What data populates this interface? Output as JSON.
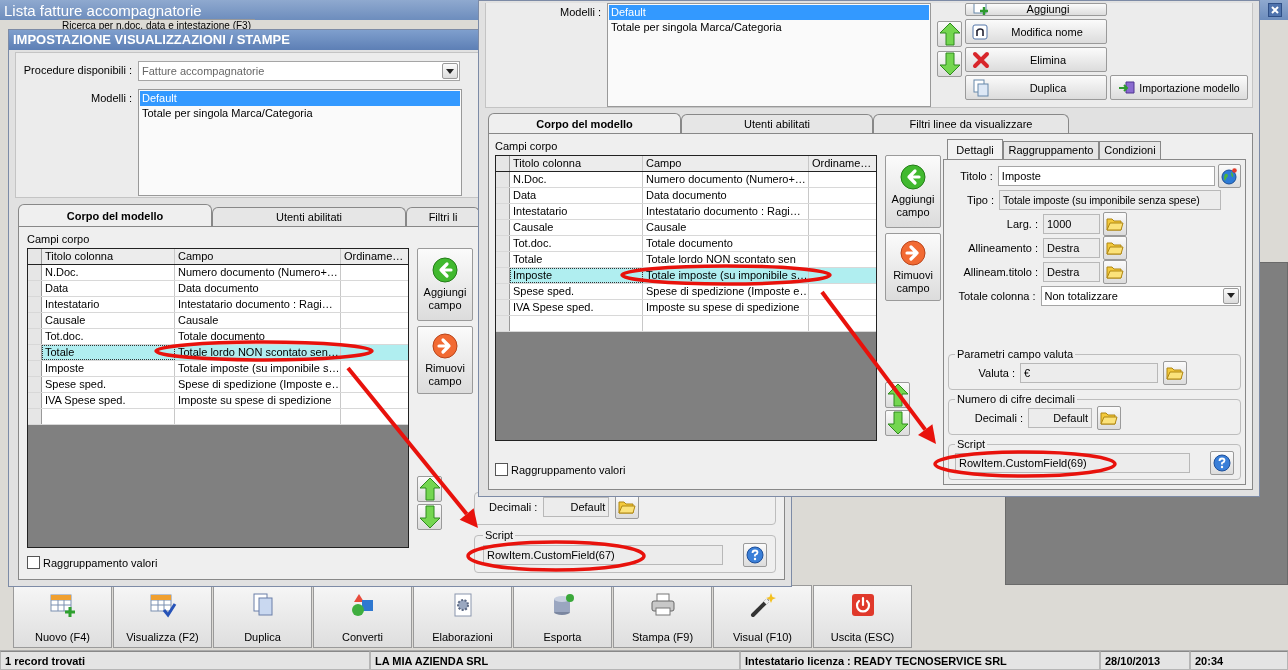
{
  "app": {
    "title": "Lista fatture accompagnatorie",
    "search_tab": "Ricerca per n.doc, data e intestazione (F3)",
    "toolbar": [
      "Nuovo (F4)",
      "Visualizza (F2)",
      "Duplica",
      "Converti",
      "Elaborazioni",
      "Esporta",
      "Stampa (F9)",
      "Visual (F10)",
      "Uscita (ESC)"
    ],
    "status_bar": [
      "1 record trovati",
      "LA MIA AZIENDA SRL",
      "Intestatario licenza : READY TECNOSERVICE SRL",
      "28/10/2013",
      "20:34"
    ]
  },
  "dialog_left": {
    "title": "IMPOSTAZIONE VISUALIZZAZIONI / STAMPE",
    "procedure": {
      "label": "Procedure disponibili :",
      "value": "Fatture accompagnatorie"
    },
    "models_label": "Modelli :",
    "models": [
      {
        "name": "Default",
        "selected": true
      },
      {
        "name": "Totale per singola Marca/Categoria",
        "selected": false
      }
    ],
    "tabs": [
      {
        "label": "Corpo del modello",
        "selected": true
      },
      {
        "label": "Utenti abilitati",
        "selected": false
      },
      {
        "label": "Filtri li",
        "selected": false
      }
    ],
    "fields_label": "Campi corpo",
    "columns": [
      "Titolo colonna",
      "Campo",
      "Ordiname…"
    ],
    "rows": [
      {
        "title": "N.Doc.",
        "field": "Numero documento (Numero+…",
        "selected": false
      },
      {
        "title": "Data",
        "field": "Data documento",
        "selected": false
      },
      {
        "title": "Intestatario",
        "field": "Intestatario documento : Ragi…",
        "selected": false
      },
      {
        "title": "Causale",
        "field": "Causale",
        "selected": false
      },
      {
        "title": "Tot.doc.",
        "field": "Totale documento",
        "selected": false
      },
      {
        "title": "Totale",
        "field": "Totale lordo NON scontato sen…",
        "selected": true
      },
      {
        "title": "Imposte",
        "field": "Totale imposte (su imponibile s…",
        "selected": false
      },
      {
        "title": "Spese sped.",
        "field": "Spese di spedizione (Imposte e…",
        "selected": false
      },
      {
        "title": "IVA Spese sped.",
        "field": "Imposte su spese di spedizione",
        "selected": false
      }
    ],
    "add_field": "Aggiungi campo",
    "remove_field": "Rimuovi campo",
    "grouping": {
      "label": "Raggruppamento valori",
      "checked": false
    },
    "decimals": {
      "label": "Decimali :",
      "value": "Default"
    },
    "script": {
      "group": "Script",
      "value": "RowItem.CustomField(67)"
    }
  },
  "dialog_right": {
    "models_label": "Modelli :",
    "models": [
      {
        "name": "Default",
        "selected": true
      },
      {
        "name": "Totale per singola Marca/Categoria",
        "selected": false
      }
    ],
    "model_buttons": [
      "Aggiungi",
      "Modifica nome",
      "Elimina",
      "Duplica"
    ],
    "import_button": "Importazione modello",
    "tabs": [
      {
        "label": "Corpo del modello",
        "selected": true
      },
      {
        "label": "Utenti abilitati",
        "selected": false
      },
      {
        "label": "Filtri linee da visualizzare",
        "selected": false
      }
    ],
    "fields_label": "Campi corpo",
    "columns": [
      "Titolo colonna",
      "Campo",
      "Ordiname…"
    ],
    "rows": [
      {
        "title": "N.Doc.",
        "field": "Numero documento (Numero+…",
        "selected": false
      },
      {
        "title": "Data",
        "field": "Data documento",
        "selected": false
      },
      {
        "title": "Intestatario",
        "field": "Intestatario documento : Ragi…",
        "selected": false
      },
      {
        "title": "Causale",
        "field": "Causale",
        "selected": false
      },
      {
        "title": "Tot.doc.",
        "field": "Totale documento",
        "selected": false
      },
      {
        "title": "Totale",
        "field": "Totale lordo NON scontato sen",
        "selected": false
      },
      {
        "title": "Imposte",
        "field": "Totale imposte (su imponibile s…",
        "selected": true
      },
      {
        "title": "Spese sped.",
        "field": "Spese di spedizione (Imposte e…",
        "selected": false
      },
      {
        "title": "IVA Spese sped.",
        "field": "Imposte su spese di spedizione",
        "selected": false
      }
    ],
    "add_field": "Aggiungi campo",
    "remove_field": "Rimuovi campo",
    "grouping": {
      "label": "Raggruppamento valori",
      "checked": false
    },
    "details": {
      "tabs": [
        {
          "label": "Dettagli",
          "selected": true
        },
        {
          "label": "Raggruppamento",
          "selected": false
        },
        {
          "label": "Condizioni",
          "selected": false
        }
      ],
      "rows": [
        {
          "kind": "text",
          "label": "Titolo :",
          "value": "Imposte"
        },
        {
          "kind": "readonly",
          "label": "Tipo :",
          "value": "Totale imposte (su imponibile senza spese)"
        },
        {
          "kind": "picker",
          "label": "Larg. :",
          "value": "1000"
        },
        {
          "kind": "picker",
          "label": "Allineamento :",
          "value": "Destra"
        },
        {
          "kind": "picker",
          "label": "Allineam.titolo :",
          "value": "Destra"
        },
        {
          "kind": "select",
          "label": "Totale colonna :",
          "value": "Non totalizzare"
        }
      ],
      "currency": {
        "group": "Parametri campo valuta",
        "label": "Valuta :",
        "value": "€"
      },
      "decimals": {
        "group": "Numero di cifre decimali",
        "label": "Decimali :",
        "value": "Default"
      },
      "script": {
        "group": "Script",
        "value": "RowItem.CustomField(69)"
      }
    }
  }
}
